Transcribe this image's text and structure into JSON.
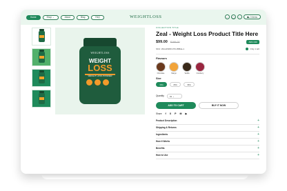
{
  "nav": {
    "menu": [
      {
        "label": "Home",
        "active": true,
        "chevron": false
      },
      {
        "label": "Shop",
        "active": false,
        "chevron": true
      },
      {
        "label": "About",
        "active": false,
        "chevron": false
      },
      {
        "label": "Blog",
        "active": false,
        "chevron": false
      },
      {
        "label": "FAQ",
        "active": false,
        "chevron": false
      }
    ],
    "logo": "WEIGHTLOSS",
    "icons": [
      "search-icon",
      "user-icon",
      "heart-icon"
    ],
    "cart_label": "0 items"
  },
  "gallery": {
    "thumbnails": [
      "thumb-1",
      "thumb-2",
      "thumb-3",
      "thumb-4"
    ]
  },
  "product_image": {
    "brand": "WEIGHTLOSS",
    "line1": "WEIGHT",
    "line2": "LOSS",
    "subtitle": "WEIGHT LOSS POWDER"
  },
  "product": {
    "collection": "COLLECTION TITLE",
    "title": "Zeal - Weight Loss Product Title Here",
    "price": "$99.00",
    "old_price": "$199.00",
    "sale_badge": "-50% OFF",
    "sku": "SKU: WLLW18W-070-35Bde-1",
    "stock": "Only 1 left",
    "flavours_label": "Flavours",
    "flavours": [
      {
        "name": "Chocolate",
        "color": "#6b3a1e"
      },
      {
        "name": "Mango",
        "color": "#f2a43a"
      },
      {
        "name": "Vanilla",
        "color": "#3a2a1a"
      },
      {
        "name": "Cranberry",
        "color": "#9a2640"
      }
    ],
    "size_label": "Size",
    "sizes": [
      {
        "label": "1KG",
        "active": true
      },
      {
        "label": "2KG",
        "active": false
      },
      {
        "label": "3KG",
        "active": false
      }
    ],
    "quantity_label": "Quantity",
    "quantity_value": "01",
    "add_to_cart": "ADD TO CART",
    "buy_now": "BUY IT NOW",
    "share_label": "Share",
    "social": [
      "f",
      "X",
      "P",
      "✉",
      "▶"
    ],
    "accordion": [
      "Product Description",
      "Shipping & Returns",
      "Ingredients",
      "How it Works",
      "Benefits",
      "How to Use"
    ]
  },
  "colors": {
    "accent": "#1f8a5b",
    "frame_bg": "#eaf6ee",
    "bottle": "#1f5c3d",
    "highlight": "#f29a2a"
  }
}
